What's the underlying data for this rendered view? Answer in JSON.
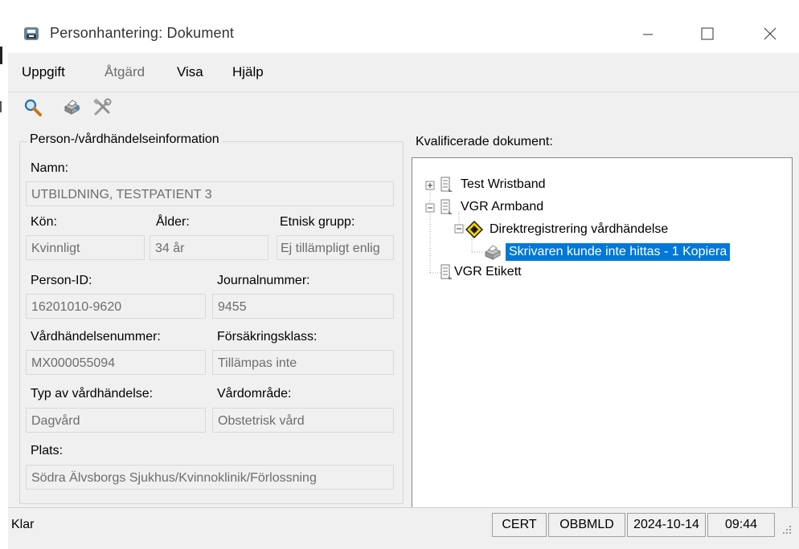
{
  "window": {
    "title": "Personhantering: Dokument"
  },
  "menu": {
    "uppgift": "Uppgift",
    "atgard": "Åtgärd",
    "visa": "Visa",
    "hjalp": "Hjälp"
  },
  "toolbar": {
    "icons": [
      "magnifier-icon",
      "printer-icon",
      "tools-icon"
    ]
  },
  "person": {
    "group_title": "Person-/vårdhändelseinformation",
    "namn_label": "Namn:",
    "namn_value": "UTBILDNING, TESTPATIENT 3",
    "kon_label": "Kön:",
    "kon_value": "Kvinnligt",
    "alder_label": "Ålder:",
    "alder_value": "34 år",
    "etnisk_label": "Etnisk grupp:",
    "etnisk_value": "Ej tillämpligt enlig",
    "personid_label": "Person-ID:",
    "personid_value": "16201010-9620",
    "journal_label": "Journalnummer:",
    "journal_value": "9455",
    "vardhandelse_label": "Vårdhändelsenummer:",
    "vardhandelse_value": "MX000055094",
    "forsakring_label": "Försäkringsklass:",
    "forsakring_value": "Tillämpas inte",
    "typ_label": "Typ av vårdhändelse:",
    "typ_value": "Dagvård",
    "vardomrade_label": "Vårdområde:",
    "vardomrade_value": "Obstetrisk vård",
    "plats_label": "Plats:",
    "plats_value": "Södra Älvsborgs Sjukhus/Kvinnoklinik/Förlossning"
  },
  "documents": {
    "label": "Kvalificerade dokument:",
    "nodes": [
      {
        "text": "Test Wristband",
        "expander": "+"
      },
      {
        "text": "VGR Armband",
        "expander": "−"
      },
      {
        "text": "Direktregistrering vårdhändelse",
        "expander": "−"
      },
      {
        "text": "Skrivaren kunde inte hittas - 1 Kopiera",
        "selected": true
      },
      {
        "text": "VGR Etikett"
      }
    ]
  },
  "status": {
    "text": "Klar",
    "env": "CERT",
    "user": "OBBMLD",
    "date": "2024-10-14",
    "time": "09:44"
  },
  "colors": {
    "selection": "#0078d7",
    "background": "#f0f0f0",
    "disabled_text": "#6d6d6d"
  }
}
